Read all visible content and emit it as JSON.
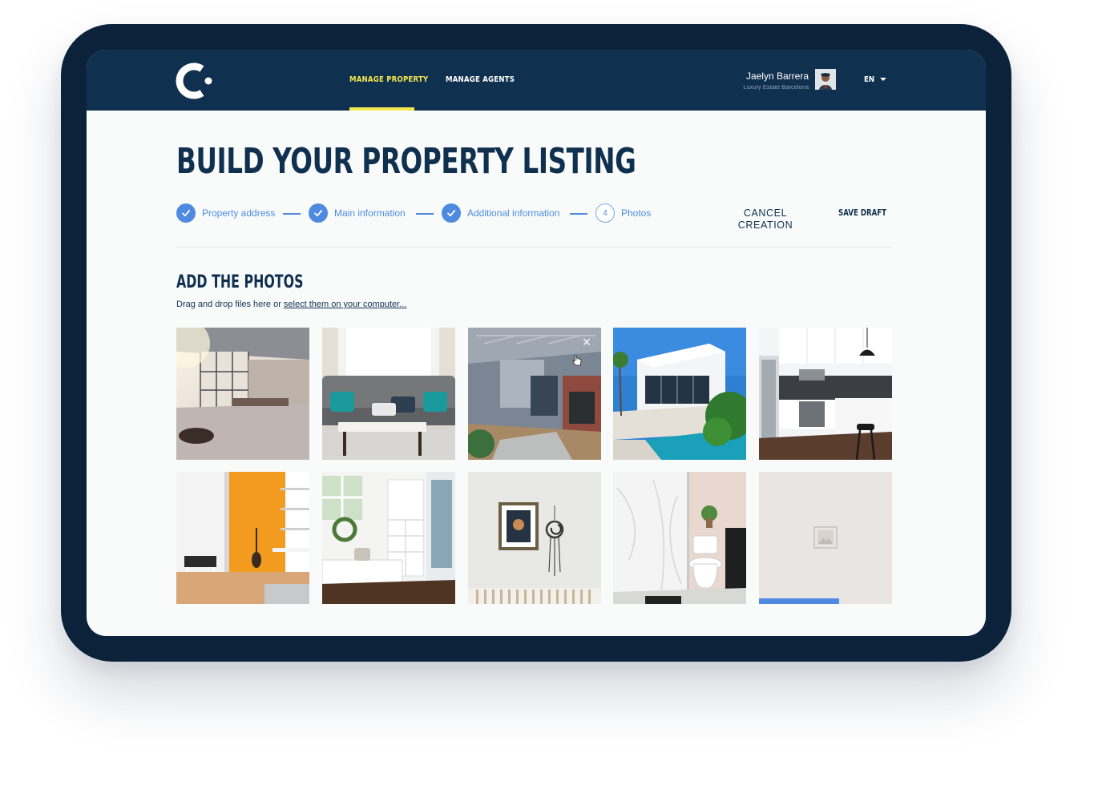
{
  "nav": {
    "items": [
      {
        "label": "MANAGE PROPERTY",
        "active": true
      },
      {
        "label": "MANAGE AGENTS",
        "active": false
      }
    ]
  },
  "user": {
    "name": "Jaelyn Barrera",
    "company": "Luxury Estate Barcelona",
    "language": "EN"
  },
  "page": {
    "title": "BUILD YOUR PROPERTY LISTING"
  },
  "stepper": {
    "steps": [
      {
        "label": "Property address",
        "state": "done"
      },
      {
        "label": "Main information",
        "state": "done"
      },
      {
        "label": "Additional information",
        "state": "done"
      },
      {
        "label": "Photos",
        "number": "4",
        "state": "current"
      }
    ]
  },
  "actions": {
    "cancel_label": "CANCEL\nCREATION",
    "save_label": "SAVE DRAFT"
  },
  "photos_section": {
    "title": "ADD THE PHOTOS",
    "hint_prefix": "Drag and drop files here or ",
    "hint_link": "select them on your computer...",
    "photos": [
      {
        "subject": "loft living room with large windows"
      },
      {
        "subject": "grey tufted sofa with teal cushions"
      },
      {
        "subject": "living room with fireplace",
        "hovered": true,
        "remove_icon": "close-icon"
      },
      {
        "subject": "modern white house with pool"
      },
      {
        "subject": "white kitchen with pendant lamp"
      },
      {
        "subject": "room with orange wall and guitar"
      },
      {
        "subject": "white mudroom bench with shelves"
      },
      {
        "subject": "white wall with framed picture"
      },
      {
        "subject": "marble bathroom with toilet"
      },
      {
        "subject": "uploading placeholder",
        "uploading": true,
        "progress": 0.6,
        "icon": "image-placeholder-icon"
      }
    ]
  },
  "colors": {
    "navy": "#10304f",
    "accent_yellow": "#f2e74f",
    "accent_blue": "#4e8be0",
    "frame": "#0b223a"
  }
}
